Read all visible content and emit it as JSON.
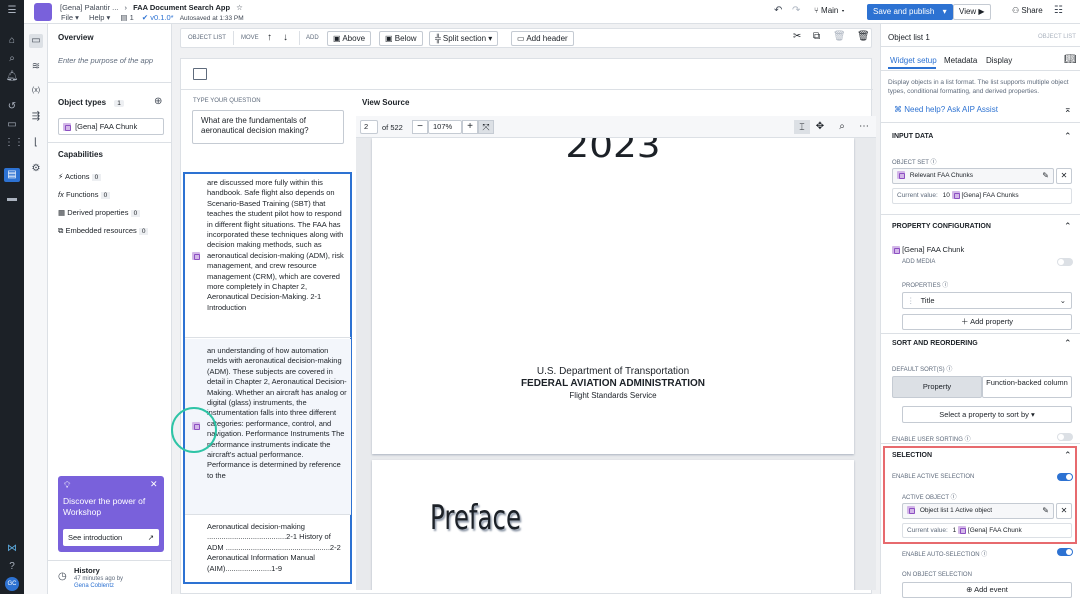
{
  "app": {
    "breadcrumb_project": "[Gena] Palantir ...",
    "title": "FAA Document Search App",
    "menu_file": "File",
    "menu_help": "Help",
    "pages_count": "1",
    "version": "v0.1.0*",
    "autosave": "Autosaved at 1:33 PM",
    "branch": "Main",
    "save_publish": "Save and publish",
    "view": "View",
    "share": "Share"
  },
  "toolbar": {
    "object_list": "OBJECT LIST",
    "move": "MOVE",
    "add": "ADD",
    "above": "Above",
    "below": "Below",
    "split": "Split section",
    "add_header": "Add header"
  },
  "left": {
    "overview": "Overview",
    "purpose_placeholder": "Enter the purpose of the app",
    "object_types": "Object types",
    "object_types_count": "1",
    "object_type": "[Gena] FAA Chunk",
    "capabilities": "Capabilities",
    "cap": [
      {
        "label": "Actions",
        "count": "0"
      },
      {
        "label": "Functions",
        "count": "0"
      },
      {
        "label": "Derived properties",
        "count": "0"
      },
      {
        "label": "Embedded resources",
        "count": "0"
      }
    ],
    "promo_title": "Discover the power of Workshop",
    "promo_btn": "See introduction",
    "history": "History",
    "history_sub": "47 minutes ago by",
    "history_user": "Gena Coblentz",
    "avatar": "GC"
  },
  "canvas": {
    "question_label": "TYPE YOUR QUESTION",
    "question": "What are the fundamentals of aeronautical decision making?",
    "view_source": "View Source",
    "page_num": "2",
    "page_of": "of 522",
    "zoom": "107%",
    "page_year": "2023",
    "dept": "U.S. Department of Transportation",
    "faa": "FEDERAL AVIATION ADMINISTRATION",
    "fss": "Flight Standards Service",
    "preface": "Preface",
    "chunks": [
      "are discussed more fully within this handbook. Safe flight also depends on Scenario-Based Training (SBT) that teaches the student pilot how to respond in different flight situations. The FAA has incorporated these techniques along with decision making methods, such as aeronautical decision-making (ADM), risk management, and crew resource management (CRM), which are covered more completely in Chapter 2, Aeronautical Decision-Making. 2-1 Introduction",
      "an understanding of how automation melds with aeronautical decision-making (ADM). These subjects are covered in detail in Chapter 2, Aeronautical Decision-Making. Whether an aircraft has analog or digital (glass) instruments, the instrumentation falls into three different categories: performance, control, and navigation. Performance Instruments The performance instruments indicate the aircraft's actual performance. Performance is determined by reference to the",
      "Aeronautical decision-making ......................................2-1 History of ADM ..................................................2-2 Aeronautical Information Manual (AIM)......................1-9"
    ]
  },
  "right": {
    "widget": "Object list 1",
    "widget_type": "OBJECT LIST",
    "tabs": [
      "Widget setup",
      "Metadata",
      "Display"
    ],
    "desc": "Display objects in a list format. The list supports multiple object types, conditional formatting, and derived properties.",
    "help": "Need help? Ask AIP Assist",
    "input_data": "INPUT DATA",
    "object_set": "OBJECT SET",
    "object_set_value": "Relevant FAA Chunks",
    "current_value": "Current value:",
    "cv_count": "10",
    "cv_name": "[Gena] FAA Chunks",
    "prop_config": "PROPERTY CONFIGURATION",
    "prop_type": "[Gena] FAA Chunk",
    "add_media": "ADD MEDIA",
    "properties": "PROPERTIES",
    "prop_title": "Title",
    "add_property": "Add property",
    "sort": "SORT AND REORDERING",
    "default_sort": "DEFAULT SORT(S)",
    "sort_property": "Property",
    "sort_function": "Function-backed column",
    "select_sort": "Select a property to sort by",
    "user_sorting": "ENABLE USER SORTING",
    "selection": "SELECTION",
    "active_sel": "ENABLE ACTIVE SELECTION",
    "active_obj": "ACTIVE OBJECT",
    "active_obj_value": "Object list 1 Active object",
    "ao_count": "1",
    "ao_name": "[Gena] FAA Chunk",
    "auto_sel": "ENABLE AUTO-SELECTION",
    "on_obj_sel": "ON OBJECT SELECTION",
    "add_event": "Add event"
  },
  "colors": {
    "accent": "#2d72d2",
    "highlight": "#e76a6e",
    "focus": "#2ec4a6",
    "promo": "#7961db"
  }
}
